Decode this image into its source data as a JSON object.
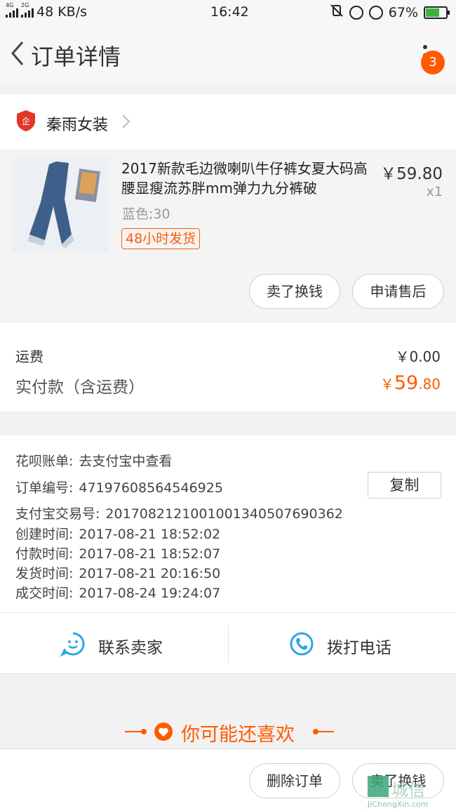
{
  "status_bar": {
    "network_speed": "48 KB/s",
    "time": "16:42",
    "battery": "67%",
    "battery_level": 0.67,
    "net_labels": [
      "4G",
      "2G"
    ]
  },
  "header": {
    "title": "订单详情",
    "badge_count": "3"
  },
  "shop": {
    "name": "秦雨女装"
  },
  "product": {
    "title": "2017新款毛边微喇叭牛仔裤女夏大码高腰显瘦流苏胖mm弹力九分裤破",
    "price": "￥59.80",
    "quantity": "x1",
    "sku": "蓝色;30",
    "tag": "48小时发货",
    "buttons": {
      "sell_exchange": "卖了换钱",
      "after_sale": "申请售后"
    }
  },
  "fees": {
    "shipping_label": "运费",
    "shipping_value": "￥0.00",
    "paid_label": "实付款（含运费）",
    "paid_currency": "￥",
    "paid_int": "59",
    "paid_dec": ".80"
  },
  "order_info": {
    "huabei_label": "花呗账单:",
    "huabei_value": "去支付宝中查看",
    "order_no_label": "订单编号:",
    "order_no_value": "471976085645469​25",
    "copy_label": "复制",
    "alipay_label": "支付宝交易号:",
    "alipay_value": "20170821210010013405076903​62",
    "created_label": "创建时间:",
    "created_value": "2017-08-21 18:52:02",
    "paid_time_label": "付款时间:",
    "paid_time_value": "2017-08-21 18:52:07",
    "shipped_label": "发货时间:",
    "shipped_value": "2017-08-21 20:16:50",
    "done_label": "成交时间:",
    "done_value": "2017-08-24 19:24:07"
  },
  "contact": {
    "seller": "联系卖家",
    "call": "拨打电话"
  },
  "recommend": {
    "title": "你可能还喜欢"
  },
  "bottom": {
    "delete_order": "删除订单",
    "sell_exchange": "卖了换钱"
  },
  "watermark": {
    "cn": "城信",
    "en": "JiChengXin.com"
  },
  "colors": {
    "accent": "#ff5a00",
    "icon_blue": "#2aa7e6"
  }
}
